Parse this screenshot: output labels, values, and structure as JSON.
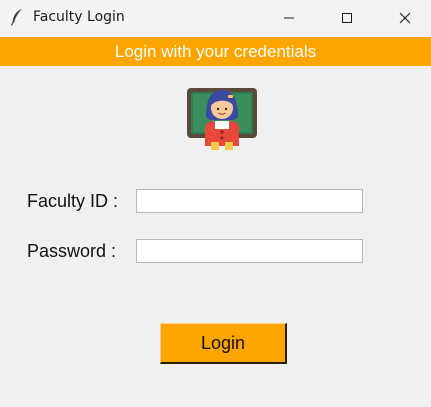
{
  "window": {
    "title": "Faculty Login",
    "icon": "feather-icon",
    "controls": [
      "minimize-icon",
      "maximize-icon",
      "close-icon"
    ]
  },
  "banner": {
    "text": "Login with your credentials",
    "color": "#ffa500"
  },
  "avatar": {
    "icon": "teacher-icon"
  },
  "form": {
    "faculty_id_label": "Faculty ID :",
    "faculty_id_value": "",
    "password_label": "Password :",
    "password_value": ""
  },
  "login_button": {
    "label": "Login",
    "color": "#ffa500"
  }
}
